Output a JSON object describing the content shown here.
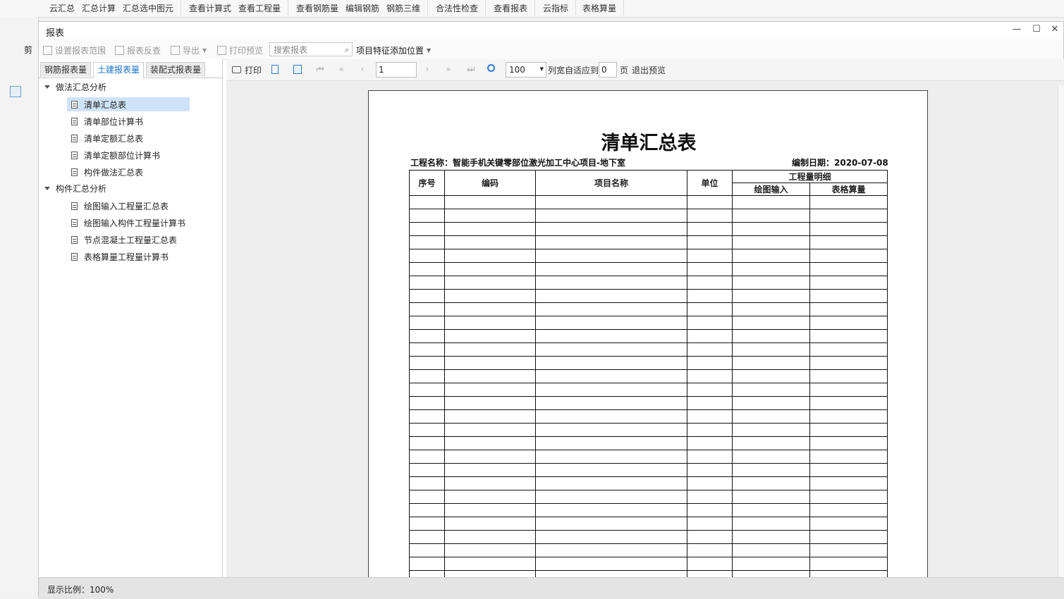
{
  "ribbon": {
    "groups": [
      [
        "云汇总",
        "汇总计算",
        "汇总选中图元"
      ],
      [
        "查看计算式",
        "查看工程量"
      ],
      [
        "查看钢筋量",
        "编辑钢筋",
        "钢筋三维"
      ],
      [
        "合法性检查"
      ],
      [
        "查看报表"
      ],
      [
        "云指标"
      ],
      [
        "表格算量"
      ]
    ]
  },
  "bg_left": {
    "cut_label": "剪"
  },
  "dialog": {
    "title": "报表",
    "controls": {
      "minimize": "—",
      "maximize": "☐",
      "close": "✕"
    }
  },
  "toolbar": {
    "set_range": "设置报表范围",
    "reverse_check": "报表反查",
    "export": "导出",
    "print_preview": "打印预览",
    "search_placeholder": "搜索报表",
    "feature_position": "项目特征添加位置"
  },
  "tabs": [
    "钢筋报表量",
    "土建报表量",
    "装配式报表量"
  ],
  "tree": {
    "groups": [
      {
        "label": "做法汇总分析",
        "items": [
          "清单汇总表",
          "清单部位计算书",
          "清单定额汇总表",
          "清单定额部位计算书",
          "构件做法汇总表"
        ]
      },
      {
        "label": "构件汇总分析",
        "items": [
          "绘图输入工程量汇总表",
          "绘图输入构件工程量计算书",
          "节点混凝土工程量汇总表",
          "表格算量工程量计算书"
        ]
      }
    ]
  },
  "preview_toolbar": {
    "print": "打印",
    "page_value": "1",
    "zoom_value": "100",
    "fit_label": "列宽自适应到",
    "fit_value": "0",
    "page_unit": "页",
    "exit_preview": "退出预览"
  },
  "report": {
    "title": "清单汇总表",
    "project_name": "工程名称：智能手机关键零部位激光加工中心项目-地下室",
    "date": "编制日期：2020-07-08",
    "headers": {
      "seq": "序号",
      "code": "编码",
      "item_name": "项目名称",
      "unit": "单位",
      "detail": "工程量明细",
      "drawing_input": "绘图输入",
      "table_calc": "表格算量"
    }
  },
  "status": {
    "text": "显示比例：100%"
  }
}
